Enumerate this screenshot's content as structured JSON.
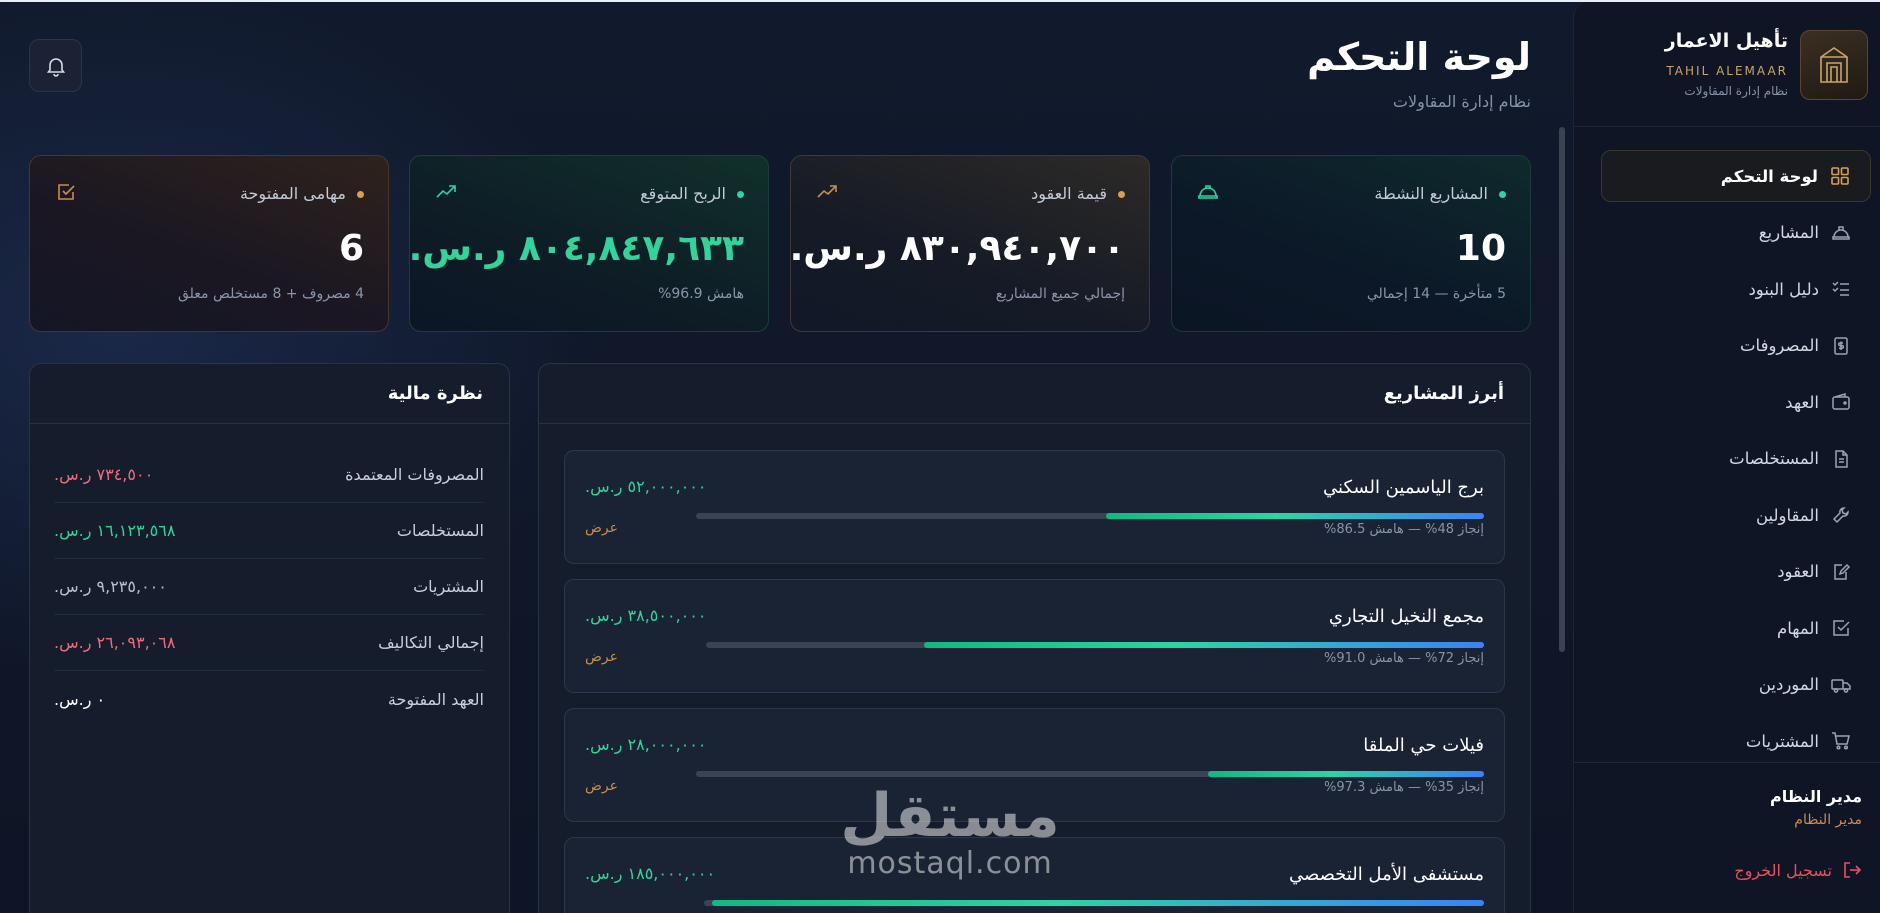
{
  "brand": {
    "name": "تأهيل الاعمار",
    "en": "TAHIL ALEMAAR",
    "sub": "نظام إدارة المقاولات"
  },
  "nav": [
    {
      "label": "لوحة التحكم",
      "icon": "grid-icon",
      "active": true
    },
    {
      "label": "المشاريع",
      "icon": "hard-hat-icon"
    },
    {
      "label": "دليل البنود",
      "icon": "checklist-icon"
    },
    {
      "label": "المصروفات",
      "icon": "dollar-receipt-icon"
    },
    {
      "label": "العهد",
      "icon": "wallet-icon"
    },
    {
      "label": "المستخلصات",
      "icon": "document-icon"
    },
    {
      "label": "المقاولين",
      "icon": "wrench-icon"
    },
    {
      "label": "العقود",
      "icon": "contract-edit-icon"
    },
    {
      "label": "المهام",
      "icon": "checkbox-icon"
    },
    {
      "label": "الموردين",
      "icon": "truck-icon"
    },
    {
      "label": "المشتريات",
      "icon": "cart-icon"
    }
  ],
  "user": {
    "name": "مدير النظام",
    "role": "مدير النظام",
    "logout": "تسجيل الخروج"
  },
  "header": {
    "title": "لوحة التحكم",
    "subtitle": "نظام إدارة المقاولات"
  },
  "stats": [
    {
      "label": "المشاريع النشطة",
      "value": "10",
      "note": "5 متأخرة — 14 إجمالي",
      "dot": "#2dd4a4",
      "icon": "hard-hat-icon"
    },
    {
      "label": "قيمة العقود",
      "value": "٨٣٠,٩٤٠,٧٠٠ ر.س.",
      "note": "إجمالي جميع المشاريع",
      "dot": "#d6a14f",
      "icon": "trending-up-icon"
    },
    {
      "label": "الربح المتوقع",
      "value": "٨٠٤,٨٤٧,٦٣٣ ر.س.",
      "note": "هامش 96.9%",
      "dot": "#2dd4a4",
      "icon": "trending-up-icon"
    },
    {
      "label": "مهامى المفتوحة",
      "value": "6",
      "note": "4 مصروف + 8 مستخلص معلق",
      "dot": "#d6a14f",
      "icon": "checkbox-icon"
    }
  ],
  "projects": {
    "title": "أبرز المشاريع",
    "view_label": "عرض",
    "items": [
      {
        "name": "برج الياسمين السكني",
        "amount": "٥٢,٠٠٠,٠٠٠ ر.س.",
        "meta": "إنجاز 48% — هامش 86.5%",
        "progress": 0.48
      },
      {
        "name": "مجمع النخيل التجاري",
        "amount": "٣٨,٥٠٠,٠٠٠ ر.س.",
        "meta": "إنجاز 72% — هامش 91.0%",
        "progress": 0.72
      },
      {
        "name": "فيلات حي الملقا",
        "amount": "٢٨,٠٠٠,٠٠٠ ر.س.",
        "meta": "إنجاز 35% — هامش 97.3%",
        "progress": 0.35
      },
      {
        "name": "مستشفى الأمل التخصصي",
        "amount": "١٨٥,٠٠٠,٠٠٠ ر.س.",
        "meta": "",
        "progress": 0.99
      }
    ]
  },
  "finance": {
    "title": "نظرة مالية",
    "rows": [
      {
        "label": "المصروفات المعتمدة",
        "value": "٧٣٤,٥٠٠ ر.س.",
        "tone": "neg"
      },
      {
        "label": "المستخلصات",
        "value": "١٦,١٢٣,٥٦٨ ر.س.",
        "tone": "pos"
      },
      {
        "label": "المشتريات",
        "value": "٩,٢٣٥,٠٠٠ ر.س.",
        "tone": "neu"
      },
      {
        "label": "إجمالي التكاليف",
        "value": "٢٦,٠٩٣,٠٦٨ ر.س.",
        "tone": "neg"
      },
      {
        "label": "العهد المفتوحة",
        "value": "٠ ر.س.",
        "tone": "wht"
      }
    ]
  },
  "watermark": {
    "ar": "مستقل",
    "en": "mostaql.com"
  }
}
